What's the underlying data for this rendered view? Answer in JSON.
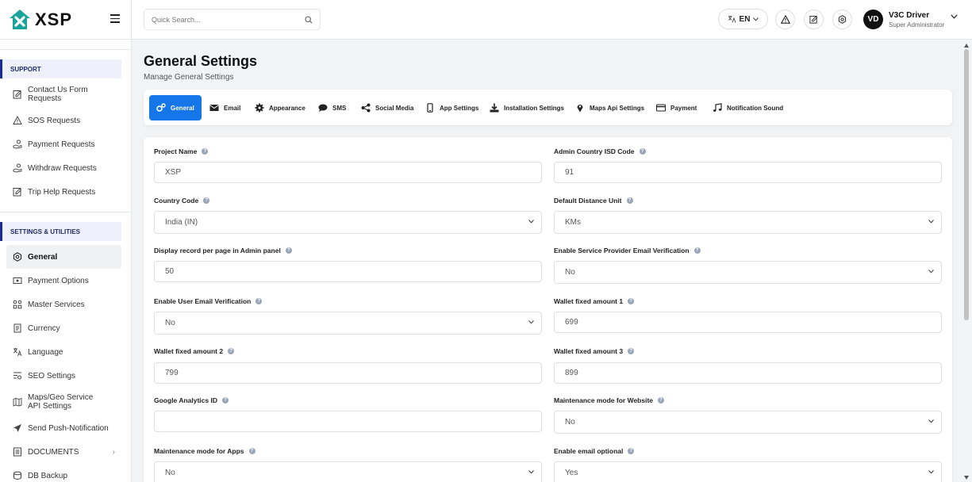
{
  "brand": {
    "name": "XSP",
    "accent": "#1476e8"
  },
  "header": {
    "search_placeholder": "Quick Search...",
    "language": "EN",
    "user": {
      "initials": "VD",
      "name": "V3C Driver",
      "role": "Super Administrator"
    }
  },
  "sidebar": {
    "support_title": "SUPPORT",
    "support_items": [
      {
        "label": "Contact Us Form Requests",
        "icon": "edit-icon"
      },
      {
        "label": "SOS Requests",
        "icon": "warning-icon"
      },
      {
        "label": "Payment Requests",
        "icon": "hand-coins-icon"
      },
      {
        "label": "Withdraw Requests",
        "icon": "hand-coins-icon"
      },
      {
        "label": "Trip Help Requests",
        "icon": "edit-icon"
      }
    ],
    "settings_title": "SETTINGS & UTILITIES",
    "settings_items": [
      {
        "label": "General",
        "icon": "gear-icon"
      },
      {
        "label": "Payment Options",
        "icon": "payment-icon"
      },
      {
        "label": "Master Services",
        "icon": "grid-icon"
      },
      {
        "label": "Currency",
        "icon": "currency-icon"
      },
      {
        "label": "Language",
        "icon": "translate-icon"
      },
      {
        "label": "SEO Settings",
        "icon": "seo-icon"
      },
      {
        "label": "Maps/Geo Service API Settings",
        "icon": "map-icon"
      },
      {
        "label": "Send Push-Notification",
        "icon": "send-icon"
      },
      {
        "label": "DOCUMENTS",
        "icon": "document-icon"
      },
      {
        "label": "DB Backup",
        "icon": "database-icon"
      }
    ]
  },
  "page": {
    "title": "General Settings",
    "subtitle": "Manage General Settings"
  },
  "tabs": [
    {
      "label": "General",
      "icon": "gears-icon"
    },
    {
      "label": "Email",
      "icon": "mail-icon"
    },
    {
      "label": "Appearance",
      "icon": "cog-icon"
    },
    {
      "label": "SMS",
      "icon": "chat-icon"
    },
    {
      "label": "Social Media",
      "icon": "share-icon"
    },
    {
      "label": "App Settings",
      "icon": "mobile-icon"
    },
    {
      "label": "Installation Settings",
      "icon": "download-icon"
    },
    {
      "label": "Maps Api Settings",
      "icon": "pin-icon"
    },
    {
      "label": "Payment",
      "icon": "card-icon"
    },
    {
      "label": "Notification Sound",
      "icon": "music-icon"
    }
  ],
  "form": {
    "fields": [
      {
        "label": "Project Name",
        "value": "XSP",
        "type": "text"
      },
      {
        "label": "Admin Country ISD Code",
        "value": "91",
        "type": "text"
      },
      {
        "label": "Country Code",
        "value": "India (IN)",
        "type": "select"
      },
      {
        "label": "Default Distance Unit",
        "value": "KMs",
        "type": "select"
      },
      {
        "label": "Display record per page in Admin panel",
        "value": "50",
        "type": "text"
      },
      {
        "label": "Enable Service Provider Email Verification",
        "value": "No",
        "type": "select"
      },
      {
        "label": "Enable User Email Verification",
        "value": "No",
        "type": "select"
      },
      {
        "label": "Wallet fixed amount 1",
        "value": "699",
        "type": "text"
      },
      {
        "label": "Wallet fixed amount 2",
        "value": "799",
        "type": "text"
      },
      {
        "label": "Wallet fixed amount 3",
        "value": "899",
        "type": "text"
      },
      {
        "label": "Google Analytics ID",
        "value": "",
        "type": "text"
      },
      {
        "label": "Maintenance mode for Website",
        "value": "No",
        "type": "select"
      },
      {
        "label": "Maintenance mode for Apps",
        "value": "No",
        "type": "select"
      },
      {
        "label": "Enable email optional",
        "value": "Yes",
        "type": "select"
      }
    ]
  }
}
